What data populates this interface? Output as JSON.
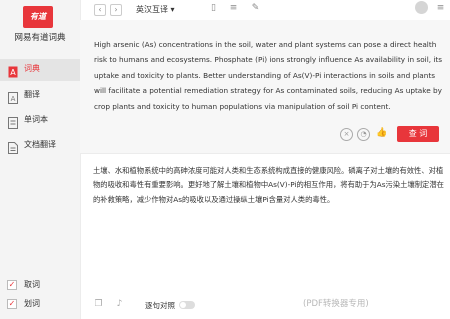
{
  "app": {
    "logo_text": "有道",
    "name": "网易有道词典"
  },
  "sidebar": {
    "items": [
      {
        "label": "词典",
        "icon": "dictionary-icon",
        "active": true
      },
      {
        "label": "翻译",
        "icon": "translate-icon",
        "active": false
      },
      {
        "label": "单词本",
        "icon": "wordbook-icon",
        "active": false
      },
      {
        "label": "文档翻译",
        "icon": "document-translate-icon",
        "active": false
      }
    ],
    "checkboxes": [
      {
        "label": "取词",
        "checked": true
      },
      {
        "label": "划词",
        "checked": true
      }
    ]
  },
  "topbar": {
    "back": "‹",
    "forward": "›",
    "language": "英汉互译 ▾"
  },
  "source": {
    "text": "High arsenic (As) concentrations in the soil, water and plant systems can pose a direct health risk to humans and ecosystems. Phosphate (Pi) ions strongly influence As availability in soil, its uptake and toxicity to plants. Better understanding of As(V)-Pi interactions in soils and plants will facilitate a potential remediation strategy for As contaminated soils, reducing As uptake by crop plants and toxicity to human populations via manipulation of soil Pi content."
  },
  "query_button": "查 词",
  "result": {
    "text": "土壤、水和植物系统中的高砷浓度可能对人类和生态系统构成直接的健康风险。磷离子对土壤的有效性、对植物的吸收和毒性有重要影响。更好地了解土壤和植物中As(V)-Pi的相互作用，将有助于为As污染土壤制定潜在的补救策略，减少作物对As的吸收以及通过操纵土壤Pi含量对人类的毒性。"
  },
  "bottom": {
    "toggle_label": "逐句对照"
  },
  "watermark": "(PDF转换器专用)",
  "colors": {
    "accent": "#e8363b"
  }
}
